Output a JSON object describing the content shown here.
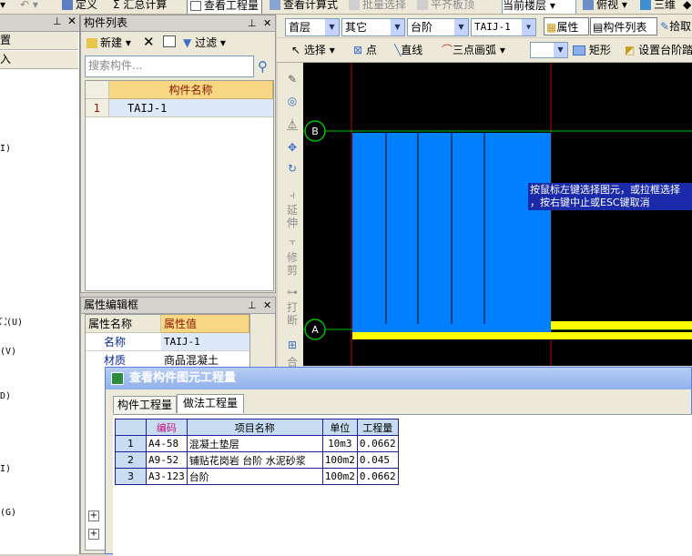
{
  "toolbar": {
    "items": [
      {
        "label": "定义"
      },
      {
        "label": "Σ 汇总计算"
      },
      {
        "label": "查看工程量"
      },
      {
        "label": "查看计算式"
      },
      {
        "label": "批量选择"
      },
      {
        "label": "平齐板顶"
      },
      {
        "label": "当前楼层"
      },
      {
        "label": "俯视"
      },
      {
        "label": "三维"
      }
    ]
  },
  "left_panel": {
    "items": [
      {
        "label": "置"
      },
      {
        "label": "入"
      }
    ],
    "tree_fragments": [
      "I)",
      "⛶(U)",
      "(V)",
      "D)",
      "I)",
      "(G)"
    ]
  },
  "component_list": {
    "title": "构件列表",
    "new_label": "新建",
    "filter_label": "过滤",
    "search_placeholder": "搜索构件...",
    "column_header": "构件名称",
    "rows": [
      {
        "num": "1",
        "name": "TAIJ-1"
      }
    ]
  },
  "property_editor": {
    "title": "属性编辑框",
    "header_name": "属性名称",
    "header_value": "属性值",
    "rows": [
      {
        "name": "名称",
        "value": "TAIJ-1"
      },
      {
        "name": "材质",
        "value": "商品混凝土"
      }
    ],
    "expanders": [
      "+",
      "+"
    ]
  },
  "right_toolbar": {
    "floor": "首层",
    "category": "其它",
    "type": "台阶",
    "component": "TAIJ-1",
    "attribute_label": "属性",
    "component_list_label": "构件列表",
    "pick_label": "拾取",
    "select_label": "选择",
    "point_label": "点",
    "line_label": "直线",
    "arc_label": "三点画弧",
    "rect_label": "矩形",
    "set_step_label": "设置台阶踏"
  },
  "vertical_tools": [
    "延伸",
    "修剪",
    "打断",
    "合"
  ],
  "canvas": {
    "axis_b": "B",
    "axis_a": "A",
    "hint_line1": "按鼠标左键选择图元，或拉框选择",
    "hint_line2": "，按右键中止或ESC键取消",
    "colors": {
      "background": "#000000",
      "slab": "#0080ff",
      "step": "#ffff00",
      "axis": "#00c000",
      "grid": "#c00000"
    }
  },
  "quantity_dialog": {
    "title": "查看构件图元工程量",
    "tabs": [
      {
        "label": "构件工程量",
        "active": false
      },
      {
        "label": "做法工程量",
        "active": true
      }
    ],
    "columns": [
      "编码",
      "项目名称",
      "单位",
      "工程量"
    ],
    "rows": [
      {
        "num": "1",
        "code": "A4-58",
        "name": "混凝土垫层",
        "unit": "10m3",
        "qty": "0.0662"
      },
      {
        "num": "2",
        "code": "A9-52",
        "name": "铺贴花岗岩 台阶 水泥砂浆",
        "unit": "100m2",
        "qty": "0.045"
      },
      {
        "num": "3",
        "code": "A3-123",
        "name": "台阶",
        "unit": "100m2",
        "qty": "0.0662"
      }
    ]
  }
}
